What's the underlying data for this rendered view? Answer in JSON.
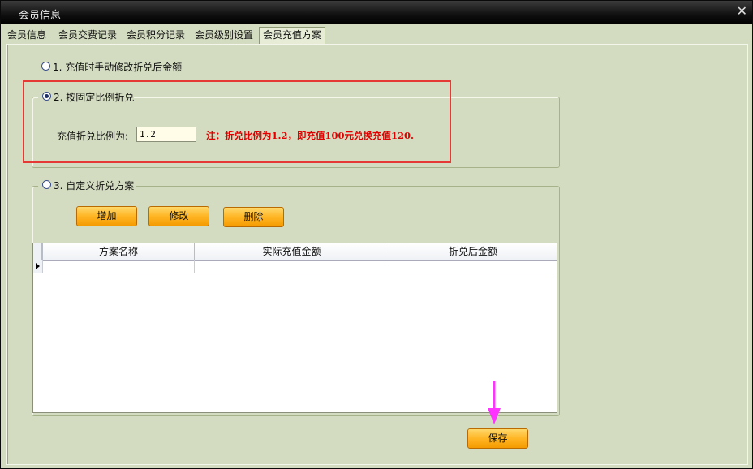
{
  "window": {
    "title": "会员信息",
    "close_glyph": "✕"
  },
  "tabs": [
    {
      "label": "会员信息"
    },
    {
      "label": "会员交费记录"
    },
    {
      "label": "会员积分记录"
    },
    {
      "label": "会员级别设置"
    },
    {
      "label": "会员充值方案",
      "active": true
    }
  ],
  "options": {
    "opt1": {
      "label": "1. 充值时手动修改折兑后金额",
      "checked": false
    },
    "opt2": {
      "label": "2. 按固定比例折兑",
      "checked": true
    },
    "opt3": {
      "label": "3. 自定义折兑方案",
      "checked": false
    }
  },
  "fixed_ratio": {
    "field_label": "充值折兑比例为:",
    "value": "1.2",
    "note": "注：折兑比例为1.2，即充值100元兑换充值120."
  },
  "custom_plan": {
    "buttons": {
      "add": "增加",
      "edit": "修改",
      "delete": "删除"
    },
    "columns": [
      "方案名称",
      "实际充值金额",
      "折兑后金额"
    ],
    "rows": [
      [
        "",
        "",
        ""
      ]
    ]
  },
  "footer": {
    "save_label": "保存"
  },
  "colors": {
    "highlight_box": "#e53935",
    "note_text": "#e00000",
    "arrow": "#ff33ff",
    "button_fill": "#ffb524"
  }
}
